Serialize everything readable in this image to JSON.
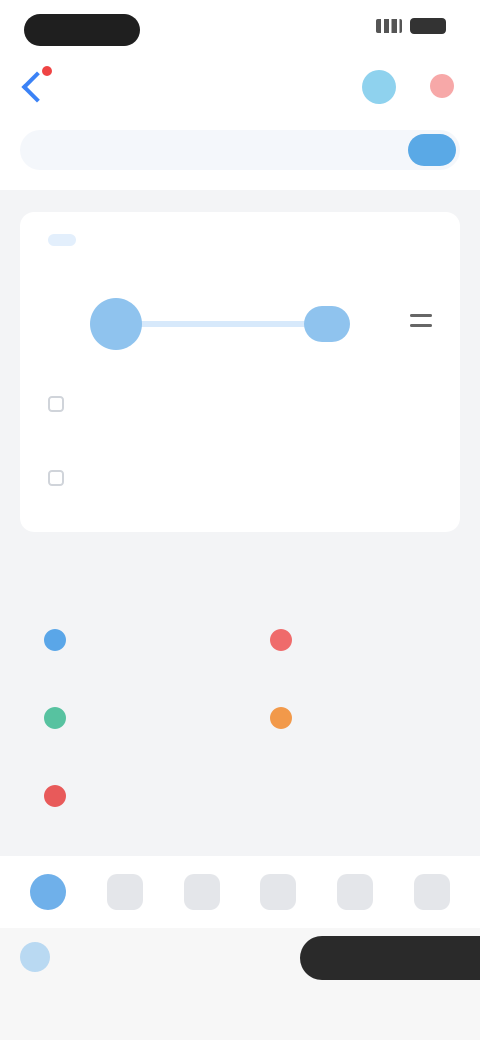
{
  "status_bar": {
    "time": "",
    "accent": "#1f1f1f"
  },
  "header": {
    "tabs": [
      {
        "label": ""
      },
      {
        "label": ""
      }
    ],
    "search": {
      "placeholder": "",
      "button": ""
    },
    "icons": [
      "back-icon",
      "headset-icon",
      "more-icon"
    ]
  },
  "booking": {
    "tabs": [
      {
        "label": ""
      },
      {
        "label": ""
      }
    ],
    "route": {
      "label": ""
    },
    "date": "",
    "class": ""
  },
  "services": {
    "title": "",
    "more": "",
    "items": [
      {
        "label": "",
        "color": "#5aa6e8"
      },
      {
        "label": "",
        "color": "#ef6b6b"
      },
      {
        "label": "",
        "color": "#57c2a0"
      },
      {
        "label": "",
        "color": "#f2994a"
      },
      {
        "label": "",
        "color": "#e85a5a"
      }
    ]
  },
  "bottom_nav": {
    "items": [
      "home-icon",
      "ticket-icon",
      "calendar-icon",
      "order-icon",
      "message-icon",
      "profile-icon"
    ]
  },
  "footer": {
    "text": "",
    "button": ""
  },
  "colors": {
    "accent": "#2f80ed",
    "background": "#f3f4f6"
  }
}
